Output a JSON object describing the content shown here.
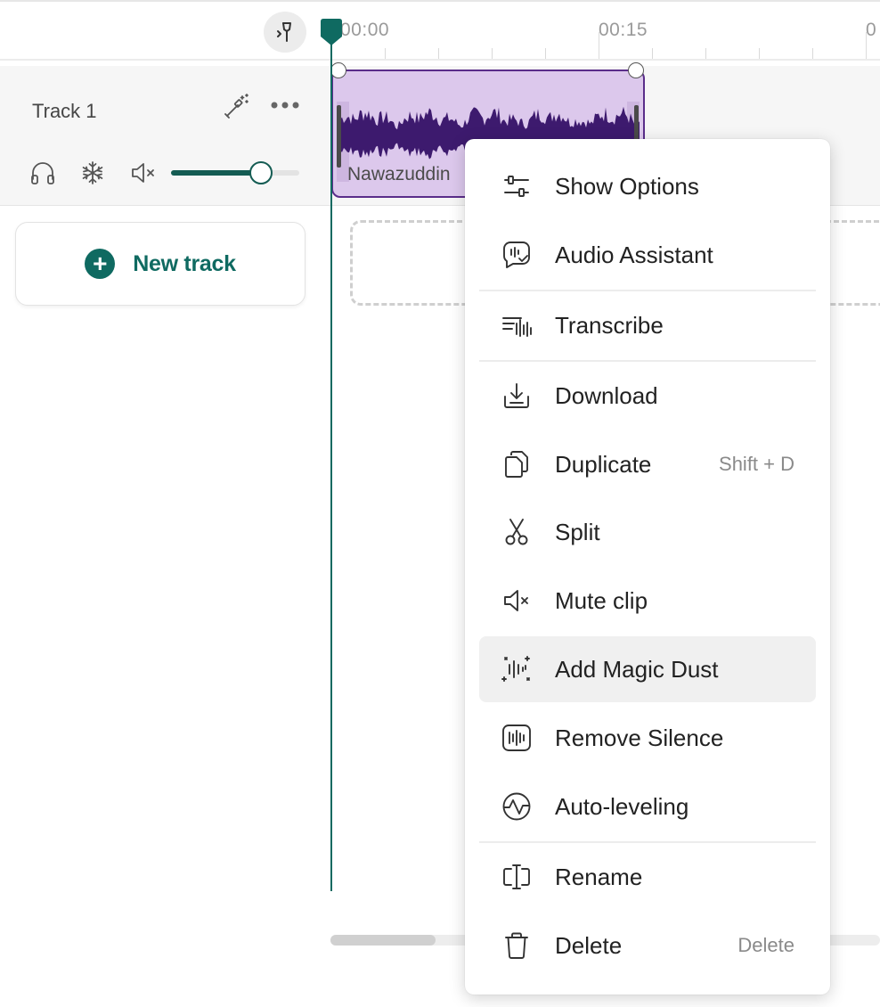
{
  "timeline": {
    "ticks": [
      "00:00",
      "00:15",
      "0"
    ]
  },
  "track": {
    "name": "Track 1",
    "volume": 0.7
  },
  "clip": {
    "name": "Nawazuddin"
  },
  "new_track": {
    "label": "New track"
  },
  "context_menu": {
    "items": [
      {
        "label": "Show Options",
        "icon": "sliders-icon",
        "shortcut": ""
      },
      {
        "label": "Audio Assistant",
        "icon": "audio-assistant-icon",
        "shortcut": ""
      },
      {
        "label": "Transcribe",
        "icon": "transcribe-icon",
        "shortcut": ""
      },
      {
        "label": "Download",
        "icon": "download-icon",
        "shortcut": ""
      },
      {
        "label": "Duplicate",
        "icon": "duplicate-icon",
        "shortcut": "Shift + D"
      },
      {
        "label": "Split",
        "icon": "scissors-icon",
        "shortcut": ""
      },
      {
        "label": "Mute clip",
        "icon": "mute-icon",
        "shortcut": ""
      },
      {
        "label": "Add Magic Dust",
        "icon": "magic-dust-icon",
        "shortcut": ""
      },
      {
        "label": "Remove Silence",
        "icon": "remove-silence-icon",
        "shortcut": ""
      },
      {
        "label": "Auto-leveling",
        "icon": "auto-leveling-icon",
        "shortcut": ""
      },
      {
        "label": "Rename",
        "icon": "rename-icon",
        "shortcut": ""
      },
      {
        "label": "Delete",
        "icon": "trash-icon",
        "shortcut": "Delete"
      }
    ],
    "highlighted": "Add Magic Dust"
  },
  "colors": {
    "accent": "#0f6a61",
    "clip_fill": "#dcc8ec",
    "clip_border": "#5a2d8a",
    "waveform": "#3d1a6e"
  }
}
